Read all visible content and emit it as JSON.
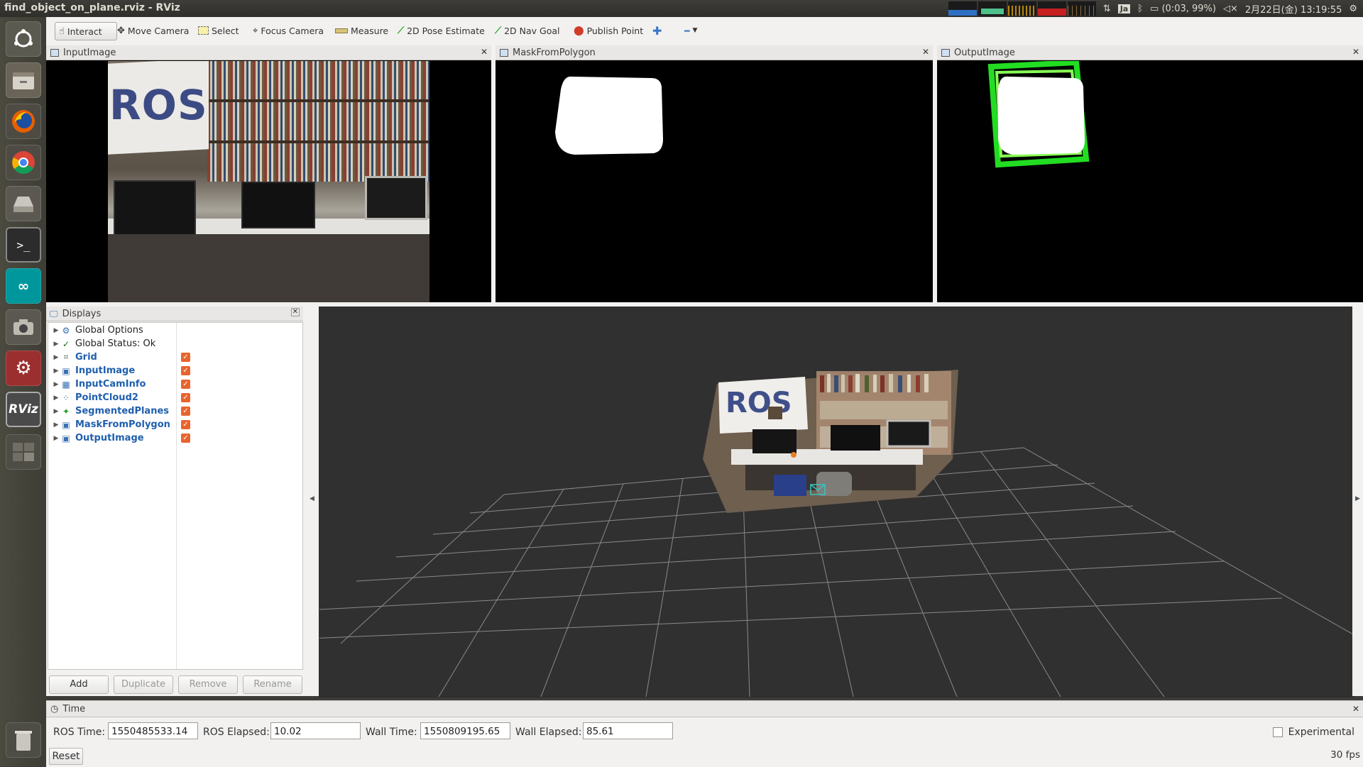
{
  "window": {
    "title": "find_object_on_plane.rviz - RViz"
  },
  "tray": {
    "ime": "Ja",
    "battery": "(0:03, 99%)",
    "datetime": "2月22日(金) 13:19:55"
  },
  "launcher": {
    "items": [
      "ubuntu-dash-icon",
      "files-icon",
      "firefox-icon",
      "chrome-icon",
      "disk-icon",
      "terminal-icon",
      "arduino-icon",
      "camera-icon",
      "settings-icon",
      "rviz-icon",
      "workspace-icon",
      "trash-icon"
    ],
    "rviz_label": "RViz"
  },
  "toolbar": {
    "tools": [
      {
        "label": "Interact",
        "icon": "cursor-icon"
      },
      {
        "label": "Move Camera",
        "icon": "move-icon"
      },
      {
        "label": "Select",
        "icon": "select-icon"
      },
      {
        "label": "Focus Camera",
        "icon": "focus-icon"
      },
      {
        "label": "Measure",
        "icon": "ruler-icon"
      },
      {
        "label": "2D Pose Estimate",
        "icon": "arrow-green-icon"
      },
      {
        "label": "2D Nav Goal",
        "icon": "arrow-green-icon"
      },
      {
        "label": "Publish Point",
        "icon": "pin-icon"
      }
    ],
    "add_icon": "plus-icon",
    "remove_icon": "minus-icon"
  },
  "image_panels": [
    {
      "title": "InputImage"
    },
    {
      "title": "MaskFromPolygon"
    },
    {
      "title": "OutputImage"
    }
  ],
  "scene_text": {
    "banner": "ROS"
  },
  "displays": {
    "title": "Displays",
    "rows": [
      {
        "label": "Global Options",
        "checked": false,
        "style": "normal"
      },
      {
        "label": "Global Status: Ok",
        "checked": false,
        "style": "normal"
      },
      {
        "label": "Grid",
        "checked": true,
        "style": "blue"
      },
      {
        "label": "InputImage",
        "checked": true,
        "style": "blue"
      },
      {
        "label": "InputCamInfo",
        "checked": true,
        "style": "blue"
      },
      {
        "label": "PointCloud2",
        "checked": true,
        "style": "blue"
      },
      {
        "label": "SegmentedPlanes",
        "checked": true,
        "style": "blue"
      },
      {
        "label": "MaskFromPolygon",
        "checked": true,
        "style": "blue"
      },
      {
        "label": "OutputImage",
        "checked": true,
        "style": "blue"
      }
    ],
    "buttons": {
      "add": "Add",
      "duplicate": "Duplicate",
      "remove": "Remove",
      "rename": "Rename"
    }
  },
  "time": {
    "title": "Time",
    "ros_time_label": "ROS Time:",
    "ros_time": "1550485533.14",
    "ros_elapsed_label": "ROS Elapsed:",
    "ros_elapsed": "10.02",
    "wall_time_label": "Wall Time:",
    "wall_time": "1550809195.65",
    "wall_elapsed_label": "Wall Elapsed:",
    "wall_elapsed": "85.61",
    "experimental_label": "Experimental",
    "reset": "Reset",
    "fps": "30 fps"
  },
  "colors": {
    "orange_check": "#e8642e",
    "blue_label": "#1f5fae",
    "polygon_green": "#22dd22",
    "viewport_bg": "#303030"
  }
}
